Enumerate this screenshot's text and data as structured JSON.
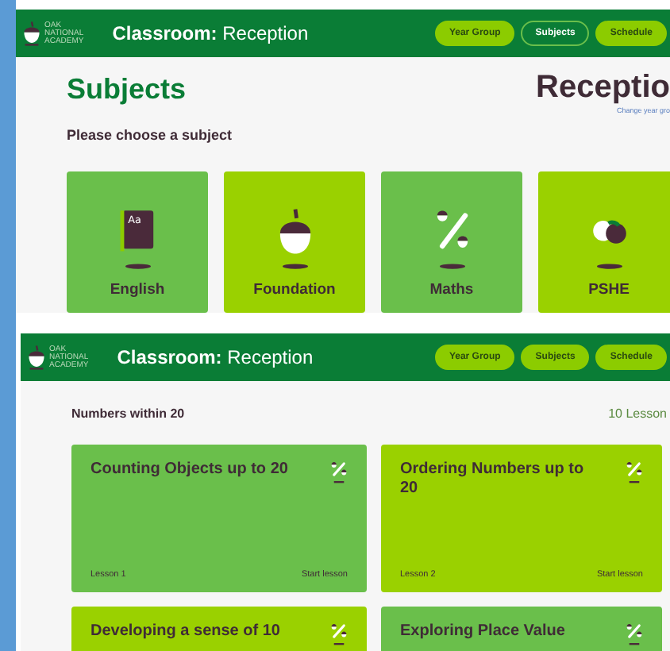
{
  "subjects_view": {
    "header": {
      "logo_text": [
        "OAK",
        "NATIONAL",
        "ACADEMY"
      ],
      "title": "**Classroom:** Reception",
      "nav": [
        {
          "label": "Year Group",
          "selected": false
        },
        {
          "label": "Subjects",
          "selected": true
        },
        {
          "label": "Schedule",
          "selected": false
        }
      ]
    },
    "heading": "Subjects",
    "year_heading": "Receptio",
    "change_link": "Change year gro",
    "prompt": "Please choose a subject",
    "subjects": [
      {
        "name": "English",
        "kind": "book",
        "icon_text": "Aa",
        "color": "#6abf4b"
      },
      {
        "name": "Foundation",
        "kind": "acorn",
        "color": "#9ad100"
      },
      {
        "name": "Maths",
        "kind": "percent",
        "color": "#6abf4b"
      },
      {
        "name": "PSHE",
        "kind": "circles",
        "color": "#9ad100"
      }
    ]
  },
  "lessons_view": {
    "header": {
      "logo_text": [
        "OAK",
        "NATIONAL",
        "ACADEMY"
      ],
      "title": "**Classroom:** Reception",
      "nav": [
        {
          "label": "Year Group",
          "selected": false
        },
        {
          "label": "Subjects",
          "selected": false
        },
        {
          "label": "Schedule",
          "selected": false
        }
      ]
    },
    "unit": "Numbers within 20",
    "count": "10 Lesson",
    "lessons": [
      {
        "title": "Counting Objects up to 20",
        "number": "Lesson 1",
        "action": "Start lesson",
        "color": "#6abf4b"
      },
      {
        "title": "Ordering Numbers up to 20",
        "number": "Lesson 2",
        "action": "Start lesson",
        "color": "#9ad100"
      },
      {
        "title": "Developing a sense of 10",
        "color": "#9ad100"
      },
      {
        "title": "Exploring Place Value",
        "color": "#6abf4b"
      }
    ]
  }
}
